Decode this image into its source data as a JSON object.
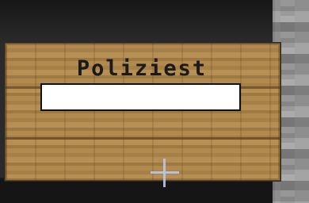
{
  "sign": {
    "lines": [
      "Poliziest",
      "",
      "",
      ""
    ],
    "editing_line": 2
  },
  "hud": {
    "crosshair": "crosshair-icon"
  },
  "colors": {
    "sign_wood": "#ab8449",
    "text": "#1a1a1a",
    "edit_box": "#ffffff",
    "crosshair": "#b8c6e8",
    "stone": "#949494"
  }
}
